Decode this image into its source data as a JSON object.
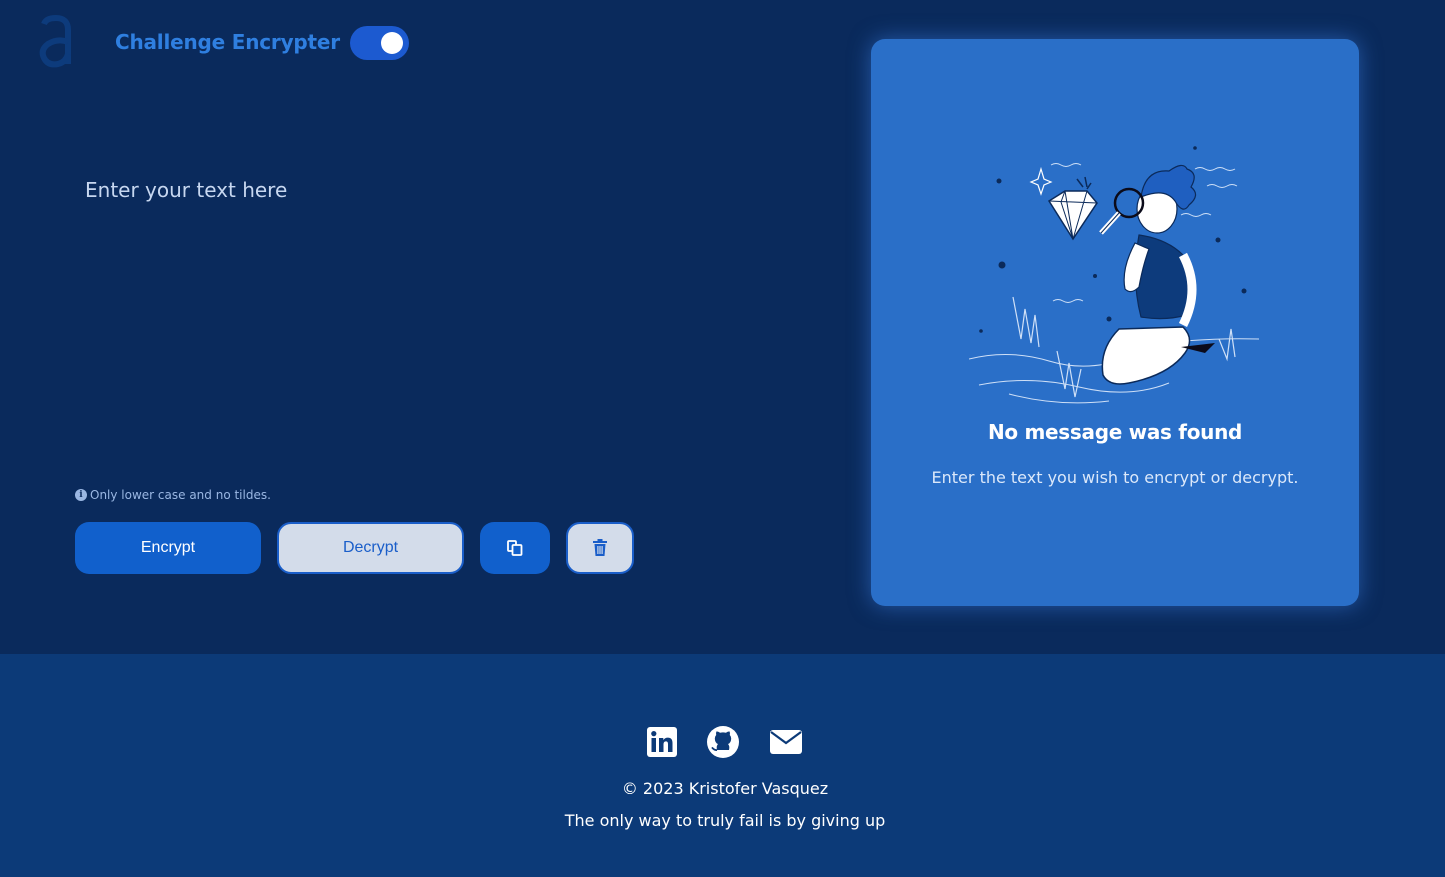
{
  "header": {
    "logo_icon": "alura-a-logo-icon",
    "title": "Challenge Encrypter",
    "theme_toggle": {
      "state": "on",
      "icon": "toggle-icon"
    }
  },
  "editor": {
    "placeholder": "Enter your text here",
    "value": "",
    "hint_icon": "info-icon",
    "hint": "Only lower case and no tildes."
  },
  "actions": {
    "encrypt_label": "Encrypt",
    "decrypt_label": "Decrypt",
    "copy_icon": "copy-icon",
    "delete_icon": "trash-icon"
  },
  "result": {
    "illustration": "person-searching-diamond-illustration",
    "title": "No message was found",
    "subtitle": "Enter the text you wish to encrypt or decrypt."
  },
  "footer": {
    "social": [
      {
        "icon": "linkedin-icon"
      },
      {
        "icon": "github-icon"
      },
      {
        "icon": "email-icon"
      }
    ],
    "copyright": "© 2023 Kristofer Vasquez",
    "motto": "The only way to truly fail is by giving up"
  },
  "colors": {
    "background": "#0a2a5c",
    "accent": "#1160cc",
    "title": "#2f7fe0",
    "card": "#2a6fc8",
    "footer": "#0c3a78"
  }
}
